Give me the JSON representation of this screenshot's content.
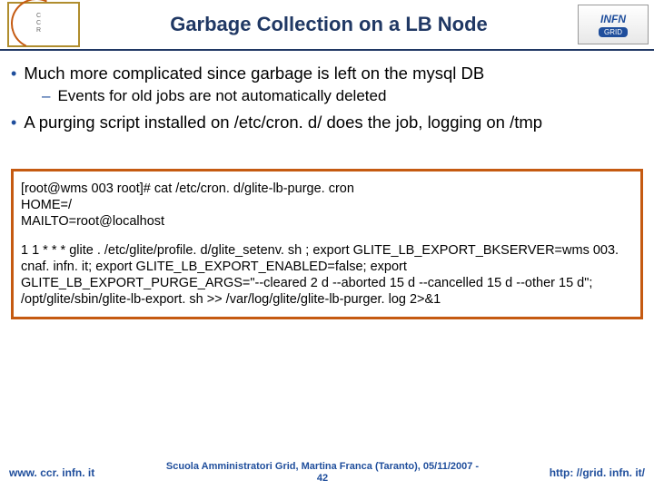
{
  "header": {
    "title": "Garbage Collection on a LB Node",
    "logo_right_top": "INFN",
    "logo_right_bottom": "GRID"
  },
  "bullets": {
    "b1": "Much more complicated since garbage is left on the mysql DB",
    "b1a": "Events for old jobs are not automatically deleted",
    "b2": "A purging script installed on /etc/cron. d/ does the job, logging on /tmp"
  },
  "code": {
    "l1": "[root@wms 003 root]# cat /etc/cron. d/glite-lb-purge. cron",
    "l2": "HOME=/",
    "l3": "MAILTO=root@localhost",
    "l4": "1 1 * * * glite . /etc/glite/profile. d/glite_setenv. sh ; export GLITE_LB_EXPORT_BKSERVER=wms 003. cnaf. infn. it; export GLITE_LB_EXPORT_ENABLED=false; export GLITE_LB_EXPORT_PURGE_ARGS=\"--cleared 2 d --aborted 15 d --cancelled 15 d --other 15 d\"; /opt/glite/sbin/glite-lb-export. sh >> /var/log/glite/glite-lb-purger. log 2>&1"
  },
  "footer": {
    "left": "www. ccr. infn. it",
    "center_line1": "Scuola Amministratori Grid, Martina Franca (Taranto), 05/11/2007 -",
    "center_line2": "42",
    "right": "http: //grid. infn. it/"
  }
}
